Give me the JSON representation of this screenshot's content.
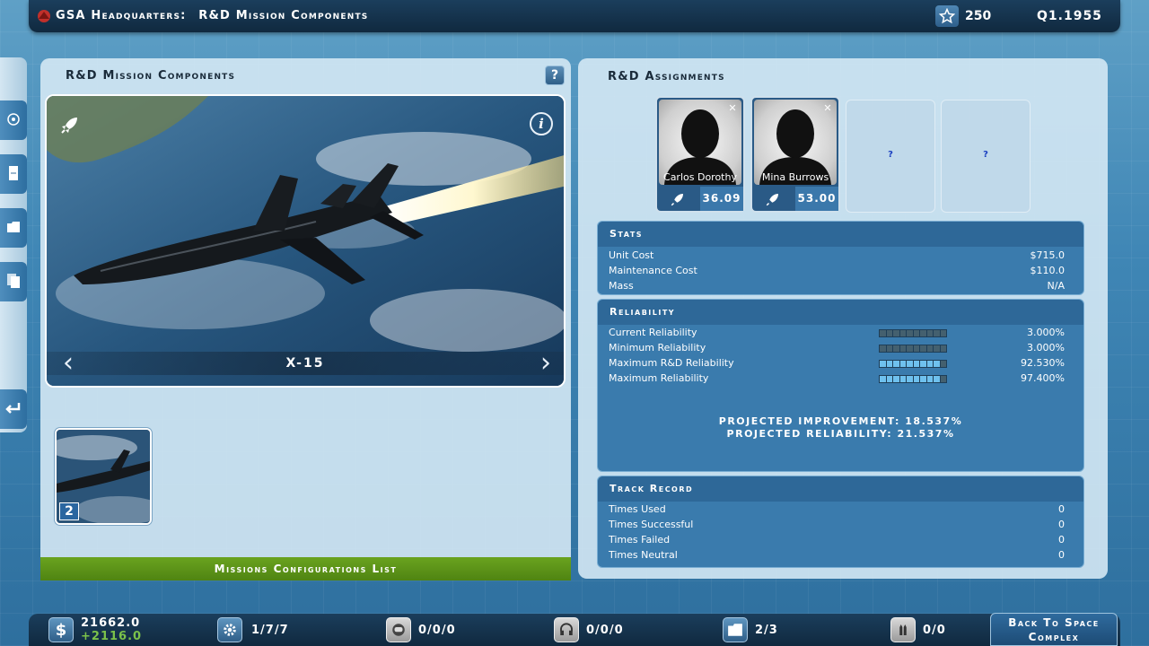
{
  "topbar": {
    "location": "GSA Headquarters:",
    "screen": "R&D Mission Components",
    "score": "250",
    "date": "Q1.1955"
  },
  "left_panel": {
    "title": "R&D Mission Components",
    "help_label": "?",
    "component_name": "X-15",
    "thumb_count": "2",
    "missions_button": "Missions Configurations List"
  },
  "right_panel": {
    "title": "R&D Assignments",
    "assignees": [
      {
        "name": "Carlos Dorothy",
        "value": "36.09"
      },
      {
        "name": "Mina Burrows",
        "value": "53.00"
      }
    ],
    "empty_slots": [
      "?",
      "?"
    ],
    "stats": {
      "header": "Stats",
      "rows": [
        {
          "label": "Unit Cost",
          "value": "$715.0"
        },
        {
          "label": "Maintenance Cost",
          "value": "$110.0"
        },
        {
          "label": "Mass",
          "value": "N/A"
        }
      ]
    },
    "reliability": {
      "header": "Reliability",
      "rows": [
        {
          "label": "Current Reliability",
          "value": "3.000%",
          "level": 0.03
        },
        {
          "label": "Minimum Reliability",
          "value": "3.000%",
          "level": 0.03
        },
        {
          "label": "Maximum R&D Reliability",
          "value": "92.530%",
          "level": 0.9253
        },
        {
          "label": "Maximum Reliability",
          "value": "97.400%",
          "level": 0.974
        }
      ],
      "projected_improvement": "PROJECTED IMPROVEMENT: 18.537%",
      "projected_reliability": "PROJECTED RELIABILITY: 21.537%"
    },
    "track_record": {
      "header": "Track Record",
      "rows": [
        {
          "label": "Times Used",
          "value": "0"
        },
        {
          "label": "Times Successful",
          "value": "0"
        },
        {
          "label": "Times Failed",
          "value": "0"
        },
        {
          "label": "Times Neutral",
          "value": "0"
        }
      ]
    }
  },
  "bottombar": {
    "funds": "21662.0",
    "income": "+2116.0",
    "engineers": "1/7/7",
    "astronauts": "0/0/0",
    "comms": "0/0/0",
    "files": "2/3",
    "rockets": "0/0",
    "back_button": "Back To Space Complex"
  },
  "colors": {
    "accent": "#3a7bad",
    "green": "#5a9417",
    "reliability_bar_on": "#6fc1ee"
  }
}
